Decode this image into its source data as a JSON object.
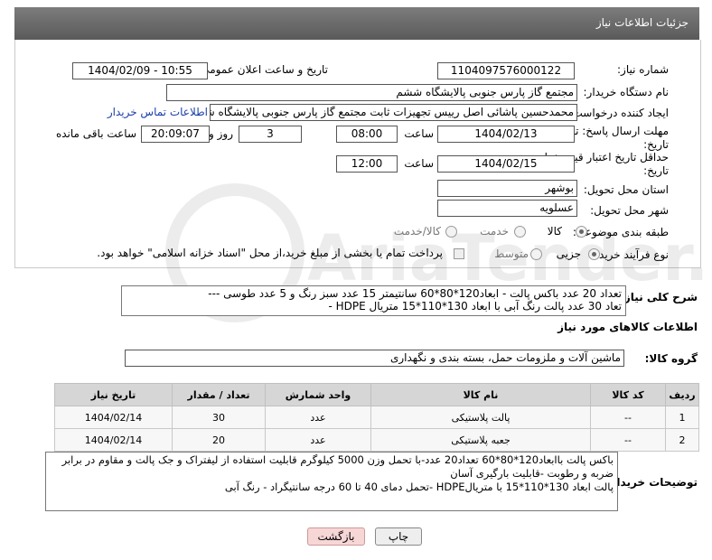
{
  "header": {
    "title": "جزئیات اطلاعات نیاز"
  },
  "fields": {
    "need_number_label": "شماره نیاز:",
    "need_number": "1104097576000122",
    "announce_label": "تاریخ و ساعت اعلان عمومی:",
    "announce_value": "1404/02/09 - 10:55",
    "buyer_org_label": "نام دستگاه خریدار:",
    "buyer_org": "مجتمع گاز پارس جنوبی  پالایشگاه ششم",
    "creator_label": "ایجاد کننده درخواست:",
    "creator": "محمدحسین پاشائی اصل رییس تجهیزات ثابت مجتمع گاز پارس جنوبی  پالایشگاه ششم",
    "contact_link": "اطلاعات تماس خریدار",
    "send_deadline_label": "مهلت ارسال پاسخ: تا تاریخ:",
    "send_date": "1404/02/13",
    "time_label": "ساعت",
    "send_time": "08:00",
    "days_value": "3",
    "day_and_label": "روز و",
    "remaining_time": "20:09:07",
    "remaining_label": "ساعت باقی مانده",
    "price_deadline_label": "حداقل تاریخ اعتبار قیمت: تا تاریخ:",
    "price_date": "1404/02/15",
    "price_time": "12:00",
    "province_label": "استان محل تحویل:",
    "province": "بوشهر",
    "city_label": "شهر محل تحویل:",
    "city": "عسلویه",
    "category_label": "طبقه بندی موضوعی:",
    "category_options": [
      "کالا",
      "خدمت",
      "کالا/خدمت"
    ],
    "category_selected": "کالا",
    "process_label": "نوع فرآیند خرید :",
    "process_options": [
      "جزیی",
      "متوسط"
    ],
    "process_selected": "جزیی",
    "payment_note": "پرداخت تمام یا بخشی از مبلغ خرید،از محل \"اسناد خزانه اسلامی\" خواهد بود."
  },
  "description": {
    "label": "شرح کلی نیاز:",
    "line1": "تعداد 20 عدد باکس پالت - ابعاد120*80*60 سانتیمتر 15 عدد سبز رنگ و 5 عدد طوسی ---",
    "line2": "تعاد 30 عدد پالت رنگ آبی با ابعاد 130*110*15 متریال HDPE -"
  },
  "goods_info_title": "اطلاعات کالاهای مورد نیاز",
  "goods_group": {
    "label": "گروه کالا:",
    "value": "ماشین آلات و ملزومات حمل، بسته بندی و نگهداری"
  },
  "table": {
    "headers": [
      "ردیف",
      "کد کالا",
      "نام کالا",
      "واحد شمارش",
      "تعداد / مقدار",
      "تاریخ نیاز"
    ],
    "rows": [
      [
        "1",
        "--",
        "پالت پلاستیکی",
        "عدد",
        "30",
        "1404/02/14"
      ],
      [
        "2",
        "--",
        "جعبه پلاستیکی",
        "عدد",
        "20",
        "1404/02/14"
      ]
    ]
  },
  "buyer_notes": {
    "label": "توضیحات خریدار:",
    "line1": "باکس پالت باابعاد120*80*60 تعداد20 عدد-با تحمل وزن 5000 کیلوگرم  قابلیت استفاده از لیفتراک و جک پالت و مقاوم در برابر",
    "line2": "ضربه و رطوبت -قابلیت بارگیری آسان",
    "line3": "پالت ابعاد 130*110*15 با متریالHDPE -تحمل دمای 40 تا 60 درجه سانتیگراد - رنگ آبی"
  },
  "buttons": {
    "print": "چاپ",
    "back": "بازگشت"
  },
  "watermark_text": "AriaTender.neT",
  "colors": {
    "header": "#6b6b6b",
    "link": "#1a3fa8",
    "back_button_bg": "#f7d6d6"
  }
}
